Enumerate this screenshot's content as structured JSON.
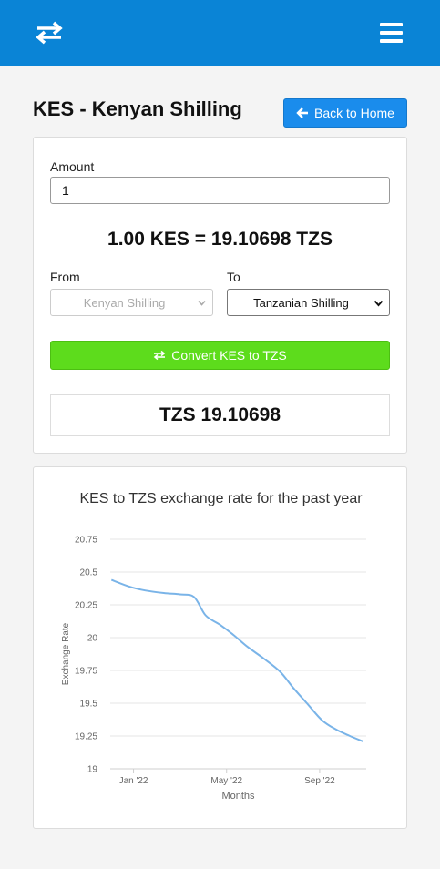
{
  "header": {
    "logo_icon": "swap-arrows-icon",
    "menu_icon": "hamburger-menu-icon",
    "color": "#0a84d6"
  },
  "page": {
    "title": "KES - Kenyan Shilling",
    "back_button_label": "Back to Home",
    "back_icon": "arrow-left-icon"
  },
  "converter": {
    "amount_label": "Amount",
    "amount_value": "1",
    "rate_text": "1.00 KES = 19.10698 TZS",
    "from_label": "From",
    "to_label": "To",
    "from_value": "Kenyan Shilling",
    "to_value": "Tanzanian Shilling",
    "convert_label": "Convert KES to TZS",
    "convert_icon": "swap-arrows-icon",
    "convert_color": "#5ddc1c",
    "result_text": "TZS 19.10698"
  },
  "chart_data": {
    "type": "line",
    "title": "KES to TZS exchange rate for the past year",
    "xlabel": "Months",
    "ylabel": "Exchange Rate",
    "x_ticks": [
      "Jan '22",
      "May '22",
      "Sep '22"
    ],
    "x_tick_positions": [
      0.5,
      4.5,
      8.5
    ],
    "xlim": [
      -0.5,
      10.5
    ],
    "ylim": [
      19,
      20.75
    ],
    "y_ticks": [
      "20.75",
      "20.5",
      "20.25",
      "20",
      "19.75",
      "19.5",
      "19.25",
      "19"
    ],
    "y_tick_values": [
      20.75,
      20.5,
      20.25,
      20,
      19.75,
      19.5,
      19.25,
      19
    ],
    "grid": true,
    "series": [
      {
        "color": "#7ab4e8",
        "x": [
          -0.45,
          0.3,
          1.0,
          1.8,
          2.5,
          3.1,
          3.6,
          4.2,
          4.8,
          5.4,
          6.1,
          6.8,
          7.4,
          8.0,
          8.6,
          9.2,
          9.8,
          10.35
        ],
        "y": [
          20.44,
          20.39,
          20.36,
          20.34,
          20.33,
          20.31,
          20.17,
          20.1,
          20.02,
          19.93,
          19.84,
          19.74,
          19.61,
          19.49,
          19.37,
          19.3,
          19.25,
          19.21
        ]
      }
    ]
  }
}
